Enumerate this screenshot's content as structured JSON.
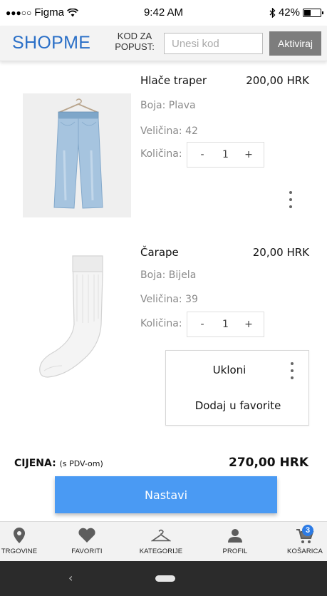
{
  "status_bar": {
    "signal_dots": "●●●○○",
    "carrier": "Figma",
    "time": "9:42 AM",
    "battery_percent": "42%",
    "battery_level": 0.42
  },
  "header": {
    "logo_part1": "SHOP",
    "logo_part2": "ME",
    "promo_label": "KOD ZA POPUST:",
    "promo_placeholder": "Unesi kod",
    "promo_value": "",
    "promo_button": "Aktiviraj",
    "brand_color": "#2a6fc7"
  },
  "cart": {
    "items": [
      {
        "name": "Hlače traper",
        "price": "200,00 HRK",
        "color": "Boja: Plava",
        "size": "Veličina: 42",
        "quantity_label": "Količina:",
        "minus": "-",
        "quantity": "1",
        "plus": "+",
        "image": "jeans-image"
      },
      {
        "name": "Čarape",
        "price": "20,00 HRK",
        "color": "Boja: Bijela",
        "size": "Veličina: 39",
        "quantity_label": "Količina:",
        "minus": "-",
        "quantity": "1",
        "plus": "+",
        "image": "sock-image"
      }
    ],
    "context_menu": {
      "remove": "Ukloni",
      "add_favorite": "Dodaj u favorite"
    }
  },
  "summary": {
    "label": "CIJENA:",
    "label_note": "(s PDV-om)",
    "total": "270,00 HRK",
    "continue_button": "Nastavi",
    "button_color": "#4a9af3"
  },
  "bottom_nav": {
    "items": [
      {
        "label": "TRGOVINE",
        "icon": "map-pin-icon"
      },
      {
        "label": "FAVORITI",
        "icon": "heart-icon"
      },
      {
        "label": "KATEGORIJE",
        "icon": "hanger-icon"
      },
      {
        "label": "PROFIL",
        "icon": "user-icon"
      },
      {
        "label": "KOŠARICA",
        "icon": "cart-icon",
        "badge": "3"
      }
    ]
  },
  "system_nav": {
    "back": "‹"
  }
}
